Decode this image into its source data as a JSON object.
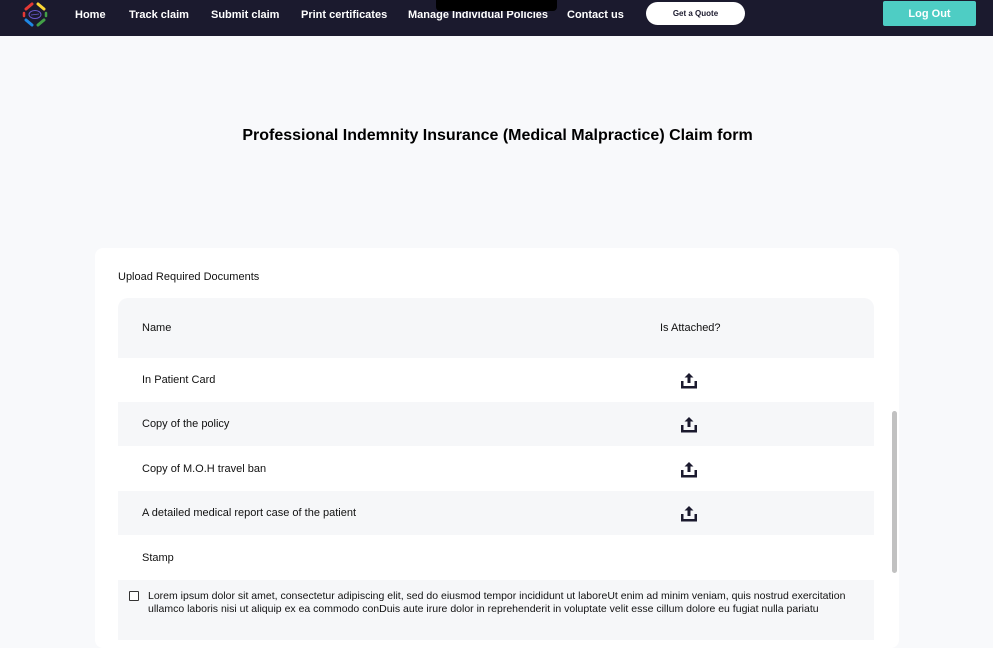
{
  "nav": {
    "links": [
      "Home",
      "Track claim",
      "Submit claim",
      "Print certificates",
      "Manage Individual Policies",
      "Contact us"
    ],
    "quote_label": "Get a Quote",
    "logout_label": "Log Out"
  },
  "page": {
    "title": "Professional Indemnity Insurance (Medical Malpractice) Claim form"
  },
  "documents": {
    "section_label": "Upload Required Documents",
    "columns": [
      "Name",
      "Is Attached?"
    ],
    "rows": [
      {
        "name": "In Patient Card",
        "upload_icon": "upload-icon"
      },
      {
        "name": "Copy of the policy",
        "upload_icon": "upload-icon"
      },
      {
        "name": "Copy of M.O.H travel ban",
        "upload_icon": "upload-icon"
      },
      {
        "name": "A detailed medical report case of the patient",
        "upload_icon": "upload-icon"
      },
      {
        "name": "Stamp"
      }
    ]
  },
  "consent": {
    "checked": false,
    "text": "Lorem ipsum dolor sit amet, consectetur adipiscing elit, sed do eiusmod tempor incididunt ut laboreUt enim ad minim veniam, quis nostrud exercitation ullamco laboris nisi ut aliquip ex ea commodo conDuis aute irure dolor in reprehenderit in voluptate velit esse cillum dolore eu fugiat nulla pariatu"
  },
  "colors": {
    "navbar": "#1b1a2e",
    "accent": "#4ecdc4"
  }
}
